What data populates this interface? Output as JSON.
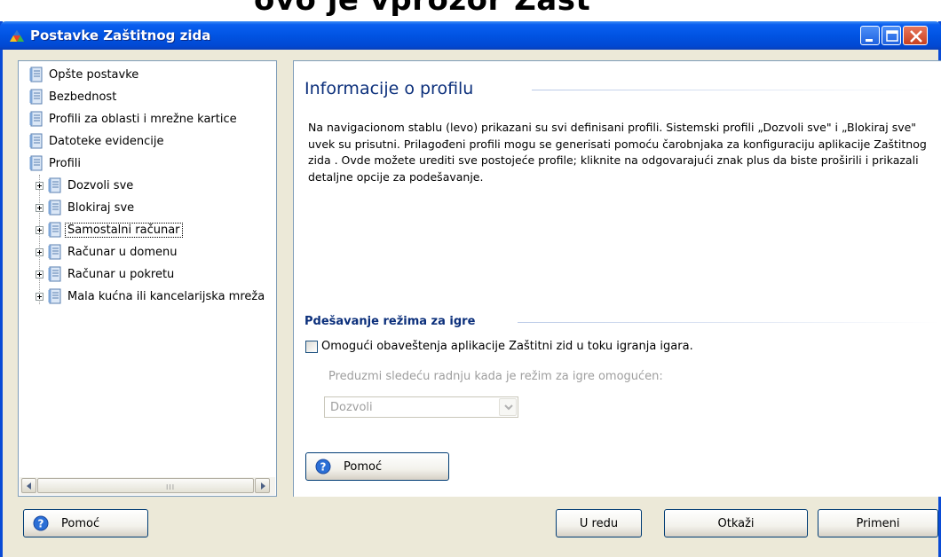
{
  "window": {
    "title": "Postavke Zaštitnog zida",
    "icon": "avg-app-icon"
  },
  "titlebar_buttons": [
    {
      "name": "minimize-icon"
    },
    {
      "name": "maximize-icon"
    },
    {
      "name": "close-icon"
    }
  ],
  "tree": {
    "items": [
      {
        "label": "Opšte postavke",
        "level": 0
      },
      {
        "label": "Bezbednost",
        "level": 0
      },
      {
        "label": "Profili za oblasti i mrežne kartice",
        "level": 0
      },
      {
        "label": "Datoteke evidencije",
        "level": 0
      },
      {
        "label": "Profili",
        "level": 0
      },
      {
        "label": "Dozvoli sve",
        "level": 1
      },
      {
        "label": "Blokiraj sve",
        "level": 1
      },
      {
        "label": "Samostalni računar",
        "level": 1,
        "selected": true
      },
      {
        "label": "Računar u domenu",
        "level": 1
      },
      {
        "label": "Računar u pokretu",
        "level": 1
      },
      {
        "label": "Mala kućna ili kancelarijska mreža",
        "level": 1
      }
    ],
    "scrollbar_grip": "III"
  },
  "content": {
    "heading": "Informacije o profilu",
    "description": "Na navigacionom stablu (levo) prikazani su svi definisani profili. Sistemski profili „Dozvoli sve\" i „Blokiraj sve\" uvek su prisutni. Prilagođeni profili mogu se generisati pomoću čarobnjaka za konfiguraciju aplikacije Zaštitnog zida . Ovde možete urediti sve postojeće profile; kliknite na odgovarajući znak plus da biste proširili i prikazali detaljne opcije za podešavanje.",
    "game_mode": {
      "heading": "Pdešavanje režima za igre",
      "checkbox_label": "Omogući obaveštenja aplikacije Zaštitni zid u toku igranja igara.",
      "checked": false,
      "action_label": "Preduzmi sledeću radnju kada je režim za igre omogućen:",
      "select_value": "Dozvoli"
    },
    "help_button": "Pomoć"
  },
  "footer": {
    "help_button": "Pomoć",
    "ok_button": "U redu",
    "cancel_button": "Otkaži",
    "apply_button": "Primeni"
  },
  "colors": {
    "titlebar": "#0154e3",
    "heading": "#0b2f7b",
    "window_bg": "#ece9d8"
  }
}
